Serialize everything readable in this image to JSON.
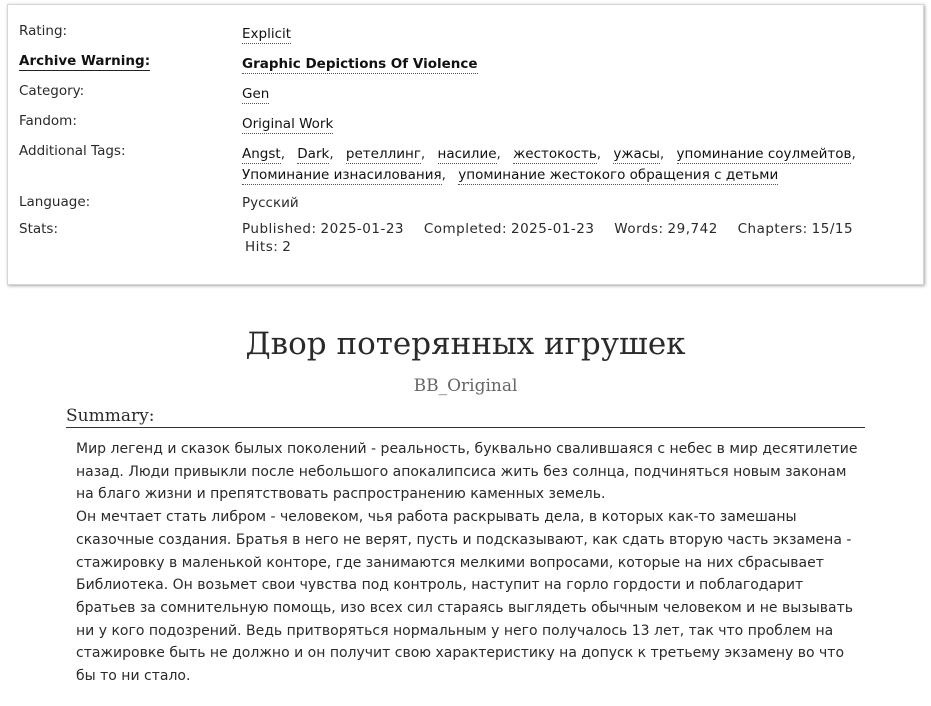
{
  "meta": {
    "rating": {
      "label": "Rating:",
      "value": "Explicit"
    },
    "warning": {
      "label": "Archive Warning:",
      "value": "Graphic Depictions Of Violence"
    },
    "category": {
      "label": "Category:",
      "value": "Gen"
    },
    "fandom": {
      "label": "Fandom:",
      "value": "Original Work"
    },
    "tags": {
      "label": "Additional Tags:",
      "items": [
        "Angst",
        "Dark",
        "ретеллинг",
        "насилие",
        "жестокость",
        "ужасы",
        "упоминание соулмейтов",
        "Упоминание изнасилования",
        "упоминание жестокого обращения с детьми"
      ]
    },
    "language": {
      "label": "Language:",
      "value": "Русский"
    },
    "stats": {
      "label": "Stats:",
      "published_label": "Published:",
      "published": "2025-01-23",
      "completed_label": "Completed:",
      "completed": "2025-01-23",
      "words_label": "Words:",
      "words": "29,742",
      "chapters_label": "Chapters:",
      "chapters": "15/15",
      "hits_label": "Hits:",
      "hits": "2"
    }
  },
  "work": {
    "title": "Двор потерянных игрушек",
    "author": "BB_Original"
  },
  "summary": {
    "heading": "Summary:",
    "paragraphs": [
      "Мир легенд и сказок былых поколений - реальность, буквально свалившаяся с небес в мир десятилетие назад. Люди привыкли после небольшого апокалипсиса жить без солнца, подчиняться новым законам на благо жизни и препятствовать распространению каменных земель.",
      "Он мечтает стать либром - человеком, чья работа раскрывать дела, в которых как-то замешаны сказочные создания. Братья в него не верят, пусть и подсказывают, как сдать вторую часть экзамена - стажировку в маленькой конторе, где занимаются мелкими вопросами, которые на них сбрасывает Библиотека. Он возьмет свои чувства под контроль, наступит на горло гордости и поблагодарит братьев за сомнительную помощь, изо всех сил стараясь выглядеть обычным человеком и не вызывать ни у кого подозрений. Ведь притворяться нормальным у него получалось 13 лет, так что проблем на стажировке быть не должно и он получит свою характеристику на допуск к третьему экзамену во что бы то ни стало."
    ]
  }
}
